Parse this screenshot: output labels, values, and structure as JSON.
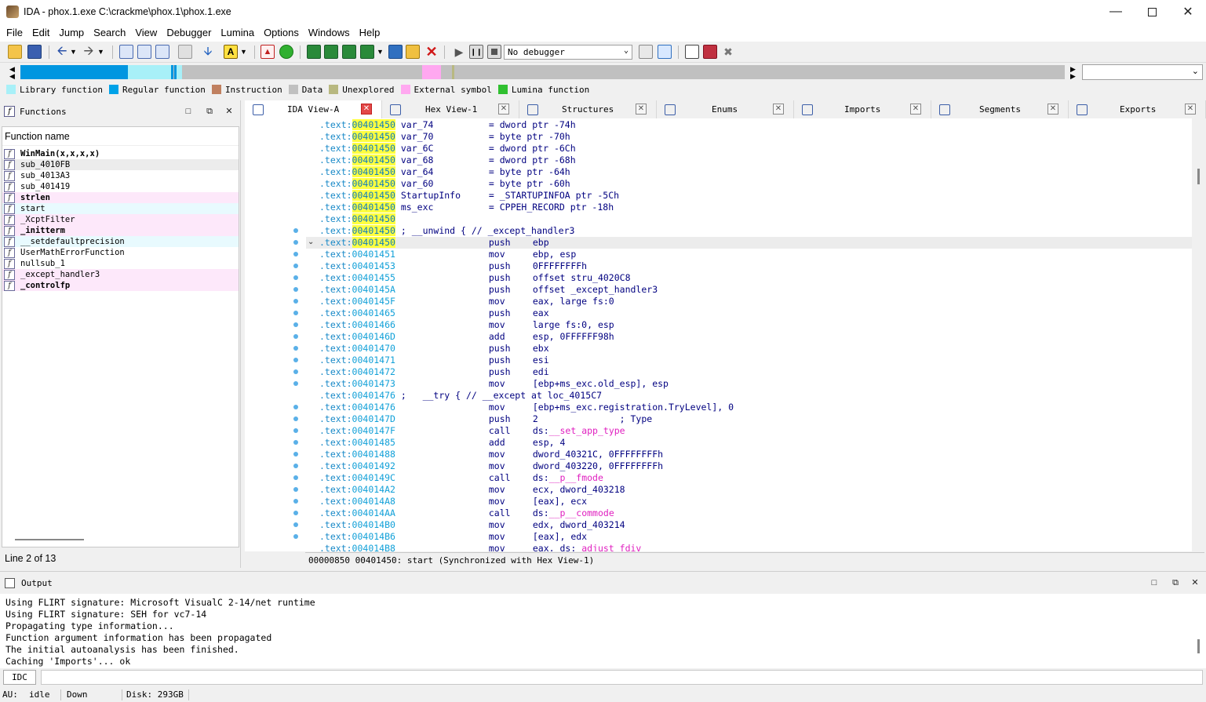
{
  "window": {
    "title": "IDA - phox.1.exe C:\\crackme\\phox.1\\phox.1.exe"
  },
  "menu": [
    "File",
    "Edit",
    "Jump",
    "Search",
    "View",
    "Debugger",
    "Lumina",
    "Options",
    "Windows",
    "Help"
  ],
  "toolbar": {
    "debugger_select": "No debugger"
  },
  "legend": [
    {
      "label": "Library function",
      "color": "#a8f0f8"
    },
    {
      "label": "Regular function",
      "color": "#00a2e8"
    },
    {
      "label": "Instruction",
      "color": "#c08060"
    },
    {
      "label": "Data",
      "color": "#c0c0c0"
    },
    {
      "label": "Unexplored",
      "color": "#b8b880"
    },
    {
      "label": "External symbol",
      "color": "#ffa8f0"
    },
    {
      "label": "Lumina function",
      "color": "#30c030"
    }
  ],
  "functions_panel": {
    "title": "Functions",
    "column_header": "Function name",
    "items": [
      {
        "name": "WinMain(x,x,x,x)",
        "bold": true,
        "bg": "#ffffff"
      },
      {
        "name": "sub_4010FB",
        "bold": false,
        "bg": "#ececec"
      },
      {
        "name": "sub_4013A3",
        "bold": false,
        "bg": "#ffffff"
      },
      {
        "name": "sub_401419",
        "bold": false,
        "bg": "#ffffff"
      },
      {
        "name": "strlen",
        "bold": true,
        "bg": "#fde8fa"
      },
      {
        "name": "start",
        "bold": false,
        "bg": "#e8fafe"
      },
      {
        "name": "_XcptFilter",
        "bold": false,
        "bg": "#fde8fa"
      },
      {
        "name": "_initterm",
        "bold": true,
        "bg": "#fde8fa"
      },
      {
        "name": "__setdefaultprecision",
        "bold": false,
        "bg": "#e8fafe"
      },
      {
        "name": "UserMathErrorFunction",
        "bold": false,
        "bg": "#ffffff"
      },
      {
        "name": "nullsub_1",
        "bold": false,
        "bg": "#ffffff"
      },
      {
        "name": "_except_handler3",
        "bold": false,
        "bg": "#fde8fa"
      },
      {
        "name": "_controlfp",
        "bold": true,
        "bg": "#fde8fa"
      }
    ],
    "status": "Line 2 of 13"
  },
  "tabs": [
    {
      "label": "IDA View-A",
      "active": true
    },
    {
      "label": "Hex View-1",
      "active": false
    },
    {
      "label": "Structures",
      "active": false
    },
    {
      "label": "Enums",
      "active": false
    },
    {
      "label": "Imports",
      "active": false
    },
    {
      "label": "Segments",
      "active": false
    },
    {
      "label": "Exports",
      "active": false
    }
  ],
  "disasm": {
    "lines": [
      {
        "seg": ".text:",
        "addr": "00401450",
        "hl": true,
        "c1": "var_74",
        "c2": "= dword ptr -74h",
        "dot": false
      },
      {
        "seg": ".text:",
        "addr": "00401450",
        "hl": true,
        "c1": "var_70",
        "c2": "= byte ptr -70h",
        "dot": false
      },
      {
        "seg": ".text:",
        "addr": "00401450",
        "hl": true,
        "c1": "var_6C",
        "c2": "= dword ptr -6Ch",
        "dot": false
      },
      {
        "seg": ".text:",
        "addr": "00401450",
        "hl": true,
        "c1": "var_68",
        "c2": "= dword ptr -68h",
        "dot": false
      },
      {
        "seg": ".text:",
        "addr": "00401450",
        "hl": true,
        "c1": "var_64",
        "c2": "= byte ptr -64h",
        "dot": false
      },
      {
        "seg": ".text:",
        "addr": "00401450",
        "hl": true,
        "c1": "var_60",
        "c2": "= byte ptr -60h",
        "dot": false
      },
      {
        "seg": ".text:",
        "addr": "00401450",
        "hl": true,
        "c1": "StartupInfo",
        "c2": "= _STARTUPINFOA ptr -5Ch",
        "dot": false
      },
      {
        "seg": ".text:",
        "addr": "00401450",
        "hl": true,
        "c1": "ms_exc",
        "c2": "= CPPEH_RECORD ptr -18h",
        "dot": false
      },
      {
        "seg": ".text:",
        "addr": "00401450",
        "hl": true,
        "c1": "",
        "c2": "",
        "dot": false
      },
      {
        "seg": ".text:",
        "addr": "00401450",
        "hl": true,
        "c1": "; __unwind { // _except_handler3",
        "c2": "",
        "dot": true
      },
      {
        "seg": ".text:",
        "addr": "00401450",
        "hl": true,
        "mn": "push",
        "ops": "ebp",
        "dot": true,
        "cur": true
      },
      {
        "seg": ".text:",
        "addr": "00401451",
        "mn": "mov",
        "ops": "ebp, esp",
        "dot": true
      },
      {
        "seg": ".text:",
        "addr": "00401453",
        "mn": "push",
        "ops": "0FFFFFFFFh",
        "dot": true
      },
      {
        "seg": ".text:",
        "addr": "00401455",
        "mn": "push",
        "ops": "offset stru_4020C8",
        "dot": true
      },
      {
        "seg": ".text:",
        "addr": "0040145A",
        "mn": "push",
        "ops": "offset _except_handler3",
        "dot": true
      },
      {
        "seg": ".text:",
        "addr": "0040145F",
        "mn": "mov",
        "ops": "eax, large fs:0",
        "dot": true
      },
      {
        "seg": ".text:",
        "addr": "00401465",
        "mn": "push",
        "ops": "eax",
        "dot": true
      },
      {
        "seg": ".text:",
        "addr": "00401466",
        "mn": "mov",
        "ops": "large fs:0, esp",
        "dot": true
      },
      {
        "seg": ".text:",
        "addr": "0040146D",
        "mn": "add",
        "ops": "esp, 0FFFFFF98h",
        "dot": true
      },
      {
        "seg": ".text:",
        "addr": "00401470",
        "mn": "push",
        "ops": "ebx",
        "dot": true
      },
      {
        "seg": ".text:",
        "addr": "00401471",
        "mn": "push",
        "ops": "esi",
        "dot": true
      },
      {
        "seg": ".text:",
        "addr": "00401472",
        "mn": "push",
        "ops": "edi",
        "dot": true
      },
      {
        "seg": ".text:",
        "addr": "00401473",
        "mn": "mov",
        "ops": "[ebp+ms_exc.old_esp], esp",
        "dot": true
      },
      {
        "seg": ".text:",
        "addr": "00401476",
        "c1": ";   __try { // __except at loc_4015C7",
        "c2": "",
        "dot": false
      },
      {
        "seg": ".text:",
        "addr": "00401476",
        "mn": "mov",
        "ops": "[ebp+ms_exc.registration.TryLevel], 0",
        "dot": true
      },
      {
        "seg": ".text:",
        "addr": "0040147D",
        "mn": "push",
        "ops": "2               ; Type",
        "dot": true
      },
      {
        "seg": ".text:",
        "addr": "0040147F",
        "mn": "call",
        "ops": "ds:",
        "imp": "__set_app_type",
        "dot": true
      },
      {
        "seg": ".text:",
        "addr": "00401485",
        "mn": "add",
        "ops": "esp, 4",
        "dot": true
      },
      {
        "seg": ".text:",
        "addr": "00401488",
        "mn": "mov",
        "ops": "dword_40321C, 0FFFFFFFFh",
        "dot": true
      },
      {
        "seg": ".text:",
        "addr": "00401492",
        "mn": "mov",
        "ops": "dword_403220, 0FFFFFFFFh",
        "dot": true
      },
      {
        "seg": ".text:",
        "addr": "0040149C",
        "mn": "call",
        "ops": "ds:",
        "imp": "__p__fmode",
        "dot": true
      },
      {
        "seg": ".text:",
        "addr": "004014A2",
        "mn": "mov",
        "ops": "ecx, dword_403218",
        "dot": true
      },
      {
        "seg": ".text:",
        "addr": "004014A8",
        "mn": "mov",
        "ops": "[eax], ecx",
        "dot": true
      },
      {
        "seg": ".text:",
        "addr": "004014AA",
        "mn": "call",
        "ops": "ds:",
        "imp": "__p__commode",
        "dot": true
      },
      {
        "seg": ".text:",
        "addr": "004014B0",
        "mn": "mov",
        "ops": "edx, dword_403214",
        "dot": true
      },
      {
        "seg": ".text:",
        "addr": "004014B6",
        "mn": "mov",
        "ops": "[eax], edx",
        "dot": true
      },
      {
        "seg": ".text:",
        "addr": "004014B8",
        "mn": "mov",
        "ops": "eax, ds:",
        "imp": "_adjust_fdiv",
        "dot": false
      }
    ],
    "status": "00000850 00401450: start (Synchronized with Hex View-1)"
  },
  "output_panel": {
    "title": "Output",
    "lines": [
      "Using FLIRT signature: Microsoft VisualC 2-14/net runtime",
      "Using FLIRT signature: SEH for vc7-14",
      "Propagating type information...",
      "Function argument information has been propagated",
      "The initial autoanalysis has been finished.",
      "Caching 'Imports'... ok"
    ],
    "idc_label": "IDC"
  },
  "statusbar": {
    "au": "AU:",
    "state": "idle",
    "direction": "Down",
    "disk": "Disk: 293GB"
  }
}
